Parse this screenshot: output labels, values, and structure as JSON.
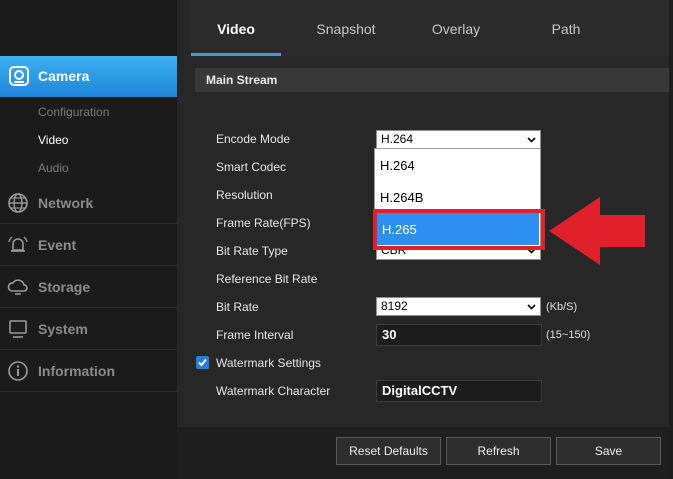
{
  "sidebar": {
    "active": {
      "label": "Camera",
      "icon": "camera-icon"
    },
    "sub_items": [
      "Configuration",
      "Video",
      "Audio"
    ],
    "sections": [
      {
        "label": "Network",
        "icon": "globe-icon"
      },
      {
        "label": "Event",
        "icon": "alarm-icon"
      },
      {
        "label": "Storage",
        "icon": "cloud-storage-icon"
      },
      {
        "label": "System",
        "icon": "monitor-icon"
      },
      {
        "label": "Information",
        "icon": "info-icon"
      }
    ]
  },
  "tabs": [
    "Video",
    "Snapshot",
    "Overlay",
    "Path"
  ],
  "section_title": "Main Stream",
  "form": {
    "encode_mode": {
      "label": "Encode Mode",
      "value": "H.264"
    },
    "smart_codec": {
      "label": "Smart Codec"
    },
    "resolution": {
      "label": "Resolution"
    },
    "frame_rate": {
      "label": "Frame Rate(FPS)"
    },
    "bit_rate_type": {
      "label": "Bit Rate Type",
      "value": "CBR"
    },
    "reference_bit_rate": {
      "label": "Reference Bit Rate"
    },
    "bit_rate": {
      "label": "Bit Rate",
      "value": "8192",
      "unit": "(Kb/S)"
    },
    "frame_interval": {
      "label": "Frame Interval",
      "value": "30",
      "range": "(15~150)"
    },
    "watermark_settings": {
      "label": "Watermark Settings",
      "checked": true
    },
    "watermark_character": {
      "label": "Watermark Character",
      "value": "DigitalCCTV"
    }
  },
  "dropdown": {
    "options": [
      "H.264",
      "H.264B",
      "H.265"
    ],
    "highlighted": "H.265"
  },
  "buttons": {
    "reset": "Reset Defaults",
    "refresh": "Refresh",
    "save": "Save"
  },
  "colors": {
    "accent_blue": "#3aa0e0",
    "highlight_red": "#e0202b",
    "selected_option": "#2d8ff0"
  }
}
